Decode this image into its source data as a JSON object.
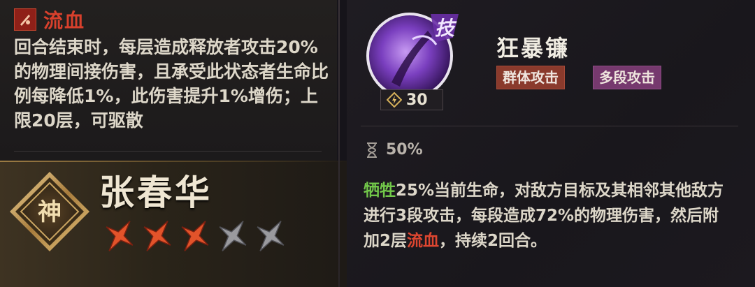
{
  "effect": {
    "name": "流血",
    "icon": "blood-slash-icon",
    "description": "回合结束时，每层造成释放者攻击20%的物理间接伤害，且承受此状态者生命比例每降低1%，此伤害提升1%增伤；上限20层，可驱散"
  },
  "character": {
    "rank_glyph": "神",
    "name": "张春华",
    "stars_filled": 3,
    "stars_total": 5
  },
  "skill": {
    "icon_glyph": "技",
    "name": "狂暴镰",
    "tags": [
      "群体攻击",
      "多段攻击"
    ],
    "cost": "30",
    "cooldown": "50%",
    "description": {
      "keyword1": "牺牲",
      "part1": "25%当前生命，对敌方目标及其相邻其他敌方进行3段攻击，每段造成72%的物理伤害，然后附加2层",
      "keyword2": "流血",
      "part2": "，持续2回合。"
    }
  },
  "colors": {
    "effect_red": "#d8402c",
    "keyword_green": "#72c84a",
    "tag_aoe": "#8a3a2c",
    "tag_multi": "#76396e",
    "star_lit": "#e2532a",
    "star_unlit": "#9a9a9e"
  }
}
